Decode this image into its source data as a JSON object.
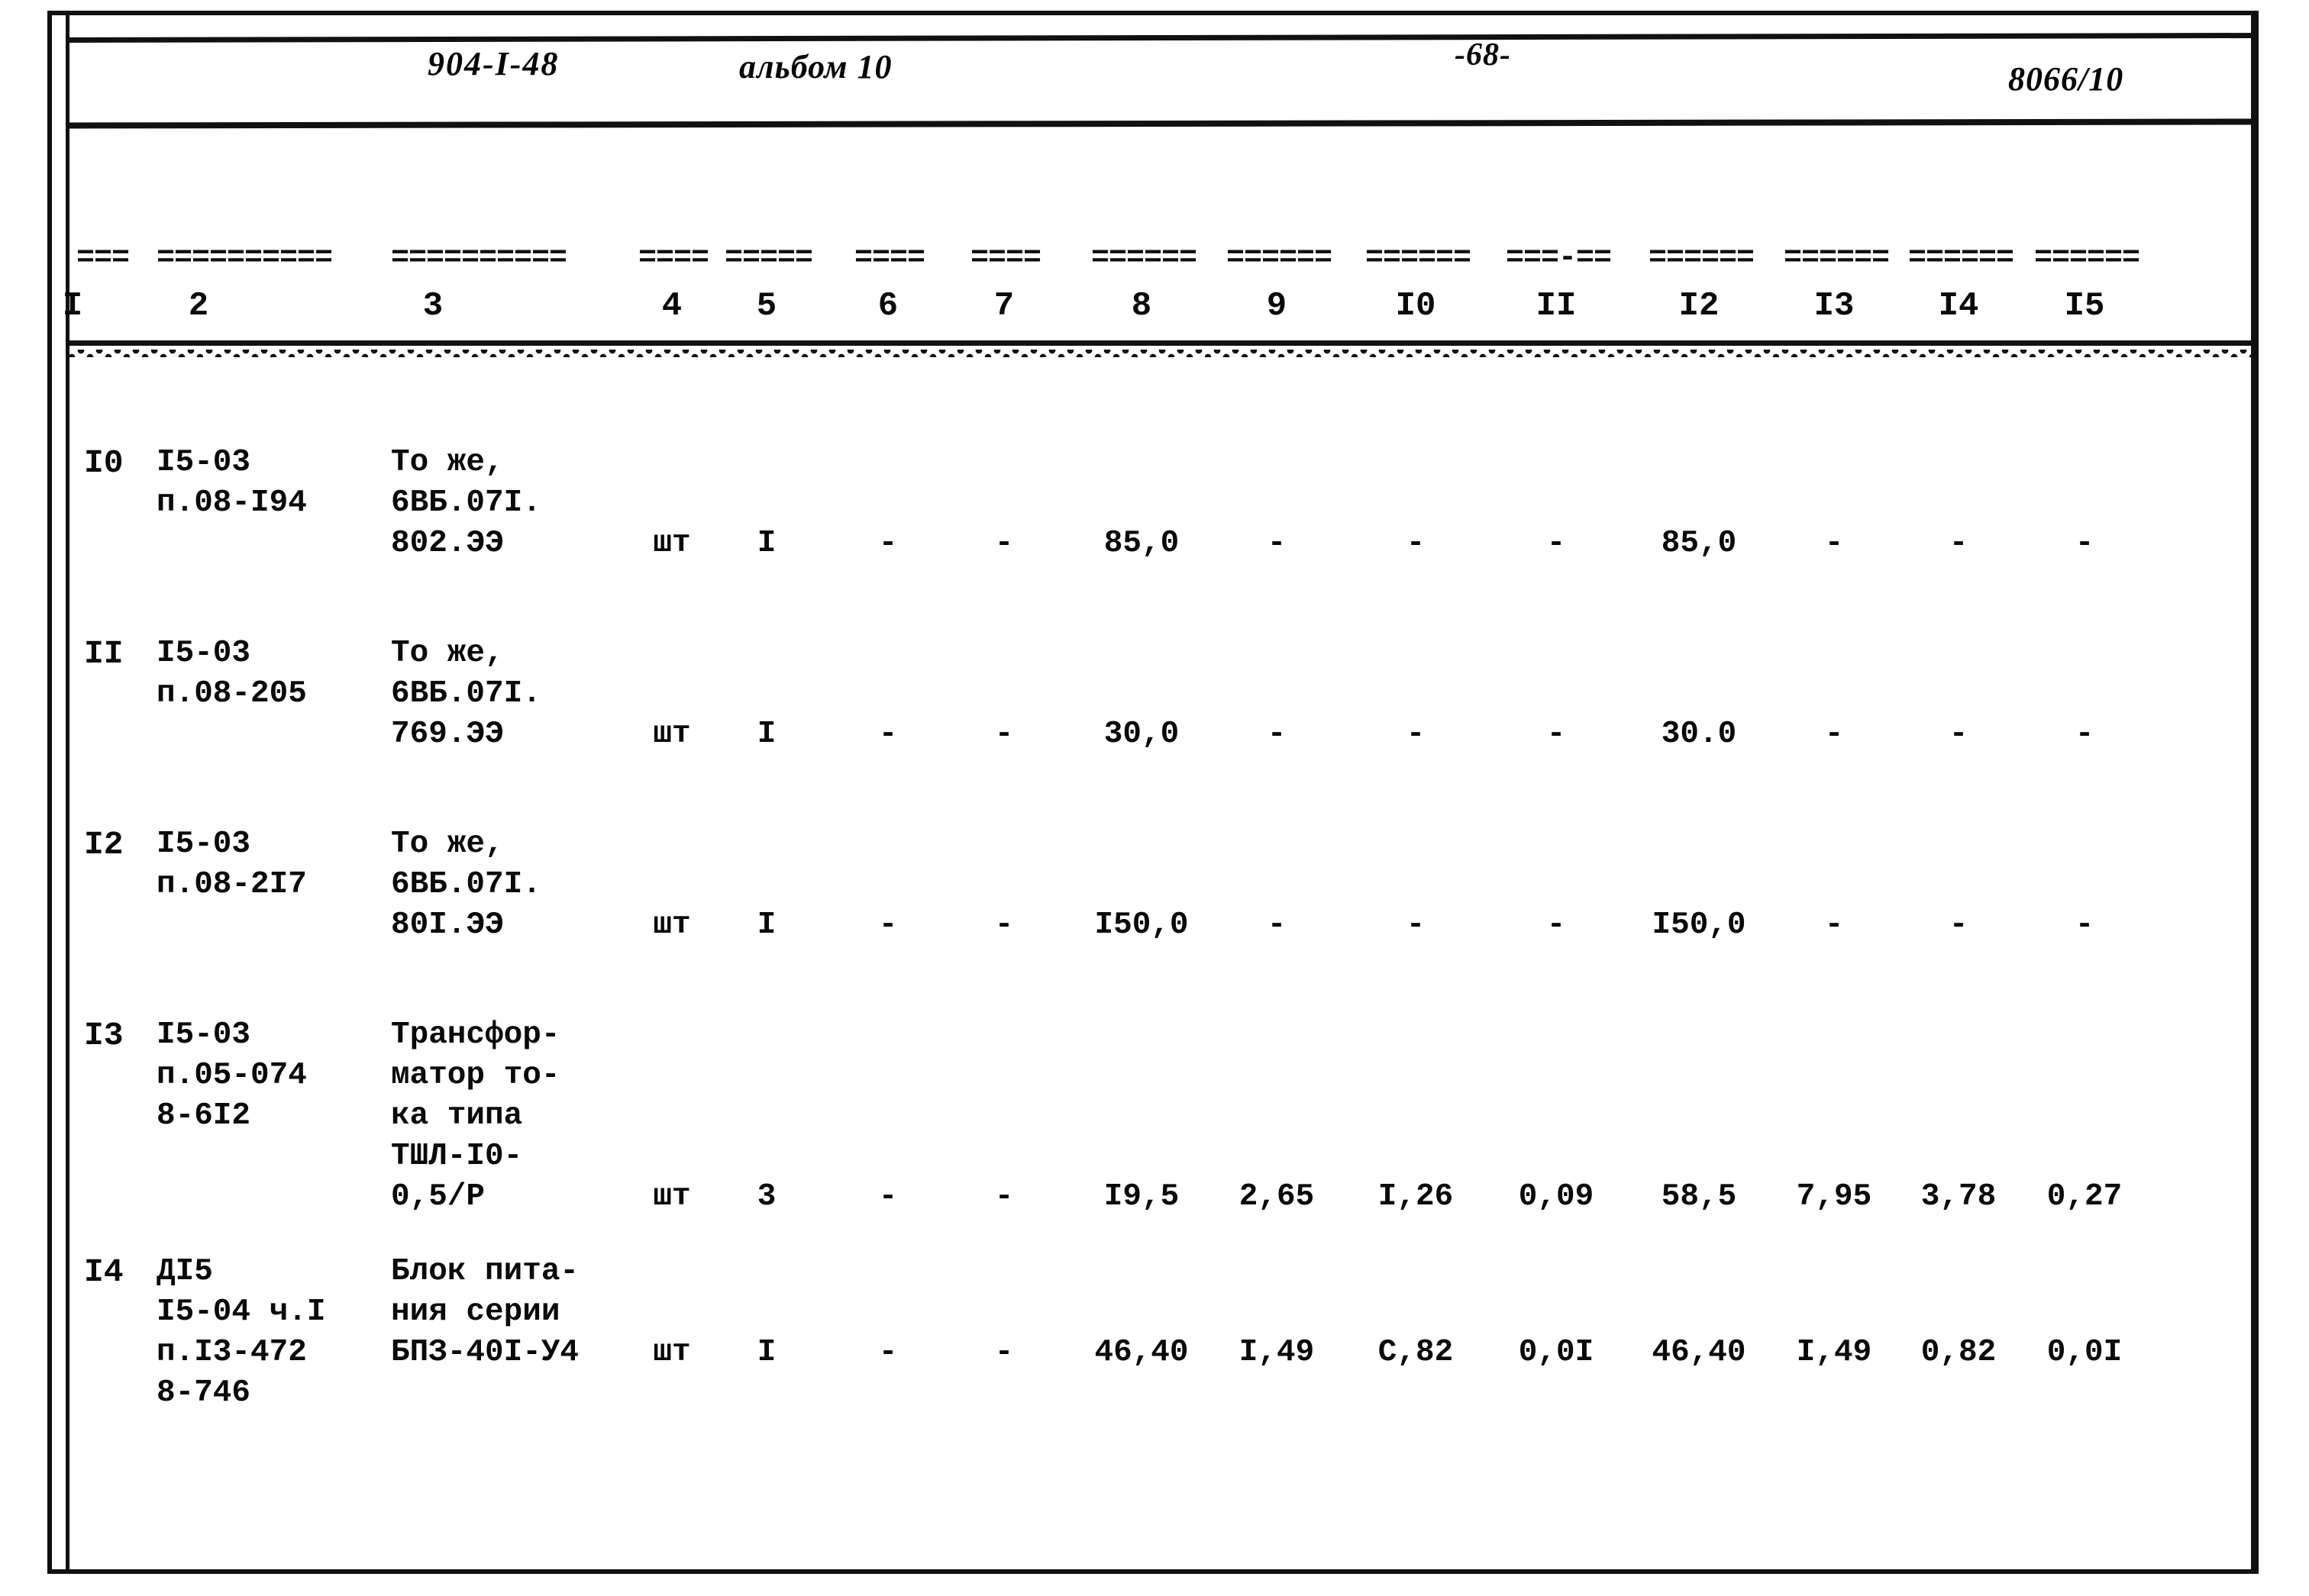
{
  "header": {
    "doc_code": "904-I-48",
    "album": "альбом 10",
    "page_number": "-68-",
    "sheet_code": "8066/10"
  },
  "table": {
    "dash_marks": [
      "===",
      "==========",
      "==========",
      "====",
      "=====",
      "====",
      "====",
      "======",
      "======",
      "======",
      "===-==",
      "======",
      "======",
      "======",
      "======"
    ],
    "column_numbers": [
      "I",
      "2",
      "3",
      "4",
      "5",
      "6",
      "7",
      "8",
      "9",
      "I0",
      "II",
      "I2",
      "I3",
      "I4",
      "I5"
    ],
    "rows": [
      {
        "no": "I0",
        "ref": [
          "I5-03",
          "п.08-I94"
        ],
        "name": [
          "То же,",
          "6ВБ.07I.",
          "802.ЭЭ"
        ],
        "unit": "шт",
        "c5": "I",
        "c6": "-",
        "c7": "-",
        "c8": "85,0",
        "c9": "-",
        "c10": "-",
        "c11": "-",
        "c12": "85,0",
        "c13": "-",
        "c14": "-",
        "c15": "-"
      },
      {
        "no": "II",
        "ref": [
          "I5-03",
          "п.08-205"
        ],
        "name": [
          "То же,",
          "6ВБ.07I.",
          "769.ЭЭ"
        ],
        "unit": "шт",
        "c5": "I",
        "c6": "-",
        "c7": "-",
        "c8": "30,0",
        "c9": "-",
        "c10": "-",
        "c11": "-",
        "c12": "30.0",
        "c13": "-",
        "c14": "-",
        "c15": "-"
      },
      {
        "no": "I2",
        "ref": [
          "I5-03",
          "п.08-2I7"
        ],
        "name": [
          "То же,",
          "6ВБ.07I.",
          "80I.ЭЭ"
        ],
        "unit": "шт",
        "c5": "I",
        "c6": "-",
        "c7": "-",
        "c8": "I50,0",
        "c9": "-",
        "c10": "-",
        "c11": "-",
        "c12": "I50,0",
        "c13": "-",
        "c14": "-",
        "c15": "-"
      },
      {
        "no": "I3",
        "ref": [
          "I5-03",
          "п.05-074",
          "8-6I2"
        ],
        "name": [
          "Трансфор-",
          "матор то-",
          "ка типа",
          "ТШЛ-I0-",
          "0,5/Р"
        ],
        "unit": "шт",
        "c5": "3",
        "c6": "-",
        "c7": "-",
        "c8": "I9,5",
        "c9": "2,65",
        "c10": "I,26",
        "c11": "0,09",
        "c12": "58,5",
        "c13": "7,95",
        "c14": "3,78",
        "c15": "0,27"
      },
      {
        "no": "I4",
        "ref": [
          "ДI5",
          "I5-04 ч.I",
          "п.I3-472",
          "8-746"
        ],
        "name": [
          "Блок пита-",
          "ния серии",
          "БПЗ-40I-У4"
        ],
        "unit": "шт",
        "c5": "I",
        "c6": "-",
        "c7": "-",
        "c8": "46,40",
        "c9": "I,49",
        "c10": "С,82",
        "c11": "0,0I",
        "c12": "46,40",
        "c13": "I,49",
        "c14": "0,82",
        "c15": "0,0I"
      }
    ]
  }
}
